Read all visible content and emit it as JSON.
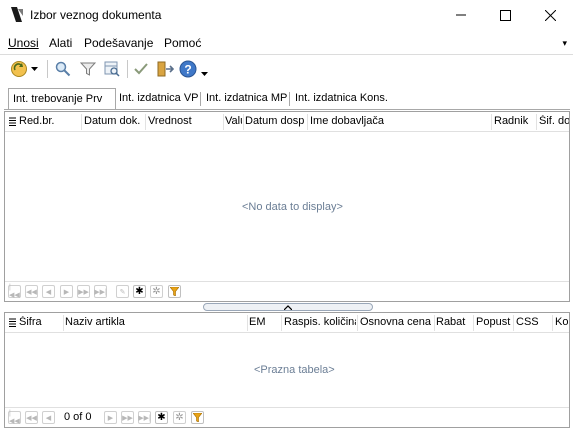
{
  "window": {
    "title": "Izbor veznog dokumenta",
    "icon": "app-logo-icon",
    "controls": {
      "minimize": "–",
      "maximize": "☐",
      "close": "✕"
    }
  },
  "menu": {
    "items": [
      "Unosi",
      "Alati",
      "Podešavanje",
      "Pomoć"
    ],
    "overflow": "▾"
  },
  "toolbar": {
    "icons": [
      "refresh-dropdown-icon",
      "search-icon",
      "filter-icon",
      "find-in-table-icon",
      "confirm-check-icon",
      "exit-door-icon",
      "help-icon"
    ],
    "more": "▾"
  },
  "tabs": [
    {
      "label": "Int. trebovanje Prv",
      "active": true
    },
    {
      "label": "Int. izdatnica VP",
      "active": false
    },
    {
      "label": "Int. izdatnica MP",
      "active": false
    },
    {
      "label": "Int. izdatnica Kons.",
      "active": false
    }
  ],
  "top_grid": {
    "columns": [
      "Red.br.",
      "Datum dok.",
      "Vrednost",
      "Valu",
      "Datum dosp",
      "Ime dobavljača",
      "Radnik",
      "Šif. do"
    ],
    "empty_text": "<No data to display>"
  },
  "bottom_grid": {
    "columns": [
      "Šifra",
      "Naziv artikla",
      "EM",
      "Raspis. količina",
      "Osnovna cena",
      "Rabat",
      "Popust",
      "CSS",
      "Kol"
    ],
    "empty_text": "<Prazna tabela>",
    "record_text": "0 of 0"
  },
  "colors": {
    "accent": "#e8a317",
    "empty_text": "#6b7e95",
    "border": "#a0a0a0"
  }
}
